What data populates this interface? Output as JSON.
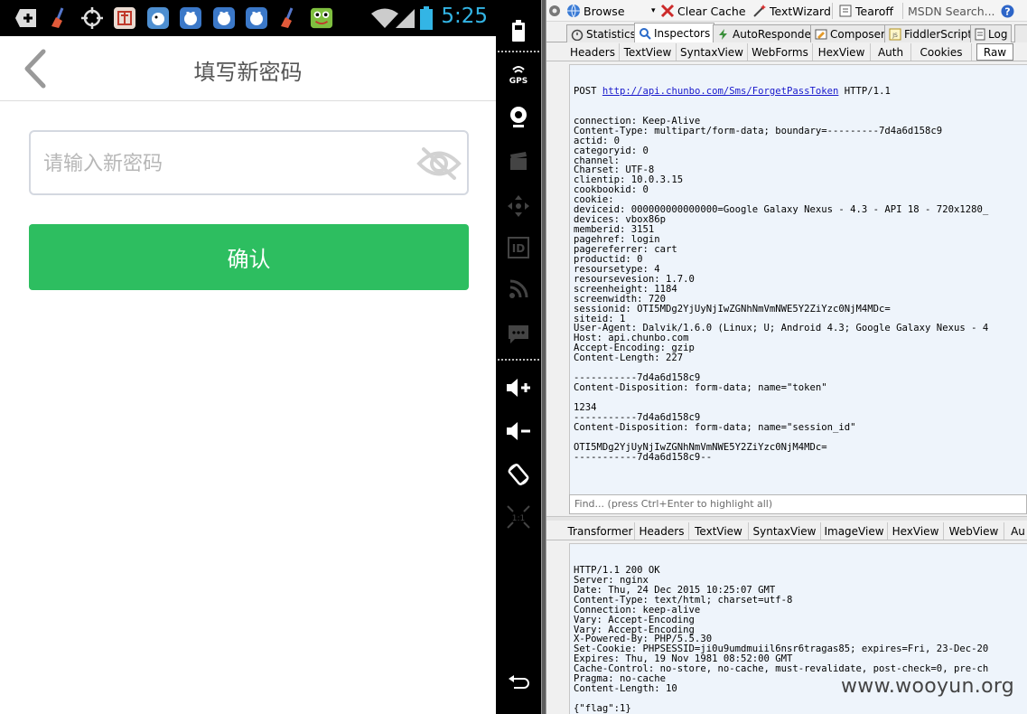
{
  "android": {
    "status_bar": {
      "time": "5:25",
      "icons": [
        "add-box-icon",
        "broom-icon",
        "crosshair-icon",
        "shop-app-icon",
        "bird-app-icon",
        "gamepad-app-icon",
        "gamepad-app-icon",
        "gamepad-app-icon",
        "broom-icon",
        "frog-app-icon",
        "wifi-icon",
        "signal-icon",
        "battery-icon"
      ]
    },
    "nav": {
      "title": "填写新密码"
    },
    "password_field": {
      "placeholder": "请输入新密码",
      "value": ""
    },
    "confirm_label": "确认"
  },
  "emulator_controls": {
    "gps_label": "GPS",
    "id_label": "ID",
    "zoom_label": "1:1",
    "buttons": [
      "battery",
      "gps",
      "camera",
      "clapper",
      "dpad",
      "id",
      "rss",
      "sms",
      "volume-up",
      "volume-down",
      "rotate",
      "zoom",
      "back"
    ]
  },
  "fiddler": {
    "toolbar": {
      "browse": "Browse",
      "clear_cache": "Clear Cache",
      "textwizard": "TextWizard",
      "tearoff": "Tearoff",
      "search_placeholder": "MSDN Search..."
    },
    "main_tabs": [
      "Statistics",
      "Inspectors",
      "AutoResponder",
      "Composer",
      "FiddlerScript",
      "Log"
    ],
    "request_tabs": [
      "Headers",
      "TextView",
      "SyntaxView",
      "WebForms",
      "HexView",
      "Auth",
      "Cookies",
      "Raw"
    ],
    "request_method": "POST",
    "request_url": "http://api.chunbo.com/Sms/ForgetPassToken",
    "request_version": "HTTP/1.1",
    "request_lines": [
      "connection: Keep-Alive",
      "Content-Type: multipart/form-data; boundary=---------7d4a6d158c9",
      "actid: 0",
      "categoryid: 0",
      "channel:",
      "Charset: UTF-8",
      "clientip: 10.0.3.15",
      "cookbookid: 0",
      "cookie:",
      "deviceid: 000000000000000=Google Galaxy Nexus - 4.3 - API 18 - 720x1280_",
      "devices: vbox86p",
      "memberid: 3151",
      "pagehref: login",
      "pagereferrer: cart",
      "productid: 0",
      "resoursetype: 4",
      "resoursevesion: 1.7.0",
      "screenheight: 1184",
      "screenwidth: 720",
      "sessionid: OTI5MDg2YjUyNjIwZGNhNmVmNWE5Y2ZiYzc0NjM4MDc=",
      "siteid: 1",
      "User-Agent: Dalvik/1.6.0 (Linux; U; Android 4.3; Google Galaxy Nexus - 4",
      "Host: api.chunbo.com",
      "Accept-Encoding: gzip",
      "Content-Length: 227",
      "",
      "-----------7d4a6d158c9",
      "Content-Disposition: form-data; name=\"token\"",
      "",
      "1234",
      "-----------7d4a6d158c9",
      "Content-Disposition: form-data; name=\"session_id\"",
      "",
      "OTI5MDg2YjUyNjIwZGNhNmVmNWE5Y2ZiYzc0NjM4MDc=",
      "-----------7d4a6d158c9--"
    ],
    "find_placeholder": "Find... (press Ctrl+Enter to highlight all)",
    "response_tabs": [
      "Transformer",
      "Headers",
      "TextView",
      "SyntaxView",
      "ImageView",
      "HexView",
      "WebView",
      "Au"
    ],
    "response_lines": [
      "HTTP/1.1 200 OK",
      "Server: nginx",
      "Date: Thu, 24 Dec 2015 10:25:07 GMT",
      "Content-Type: text/html; charset=utf-8",
      "Connection: keep-alive",
      "Vary: Accept-Encoding",
      "Vary: Accept-Encoding",
      "X-Powered-By: PHP/5.5.30",
      "Set-Cookie: PHPSESSID=ji0u9umdmuiil6nsr6tragas85; expires=Fri, 23-Dec-20",
      "Expires: Thu, 19 Nov 1981 08:52:00 GMT",
      "Cache-Control: no-store, no-cache, must-revalidate, post-check=0, pre-ch",
      "Pragma: no-cache",
      "Content-Length: 10",
      "",
      "{\"flag\":1}"
    ]
  },
  "watermark": "www.wooyun.org",
  "colors": {
    "confirm_green": "#2dbe60",
    "clock_blue": "#33b5e5",
    "code_bg": "#eef4fb",
    "link_blue": "#1a1acc"
  }
}
